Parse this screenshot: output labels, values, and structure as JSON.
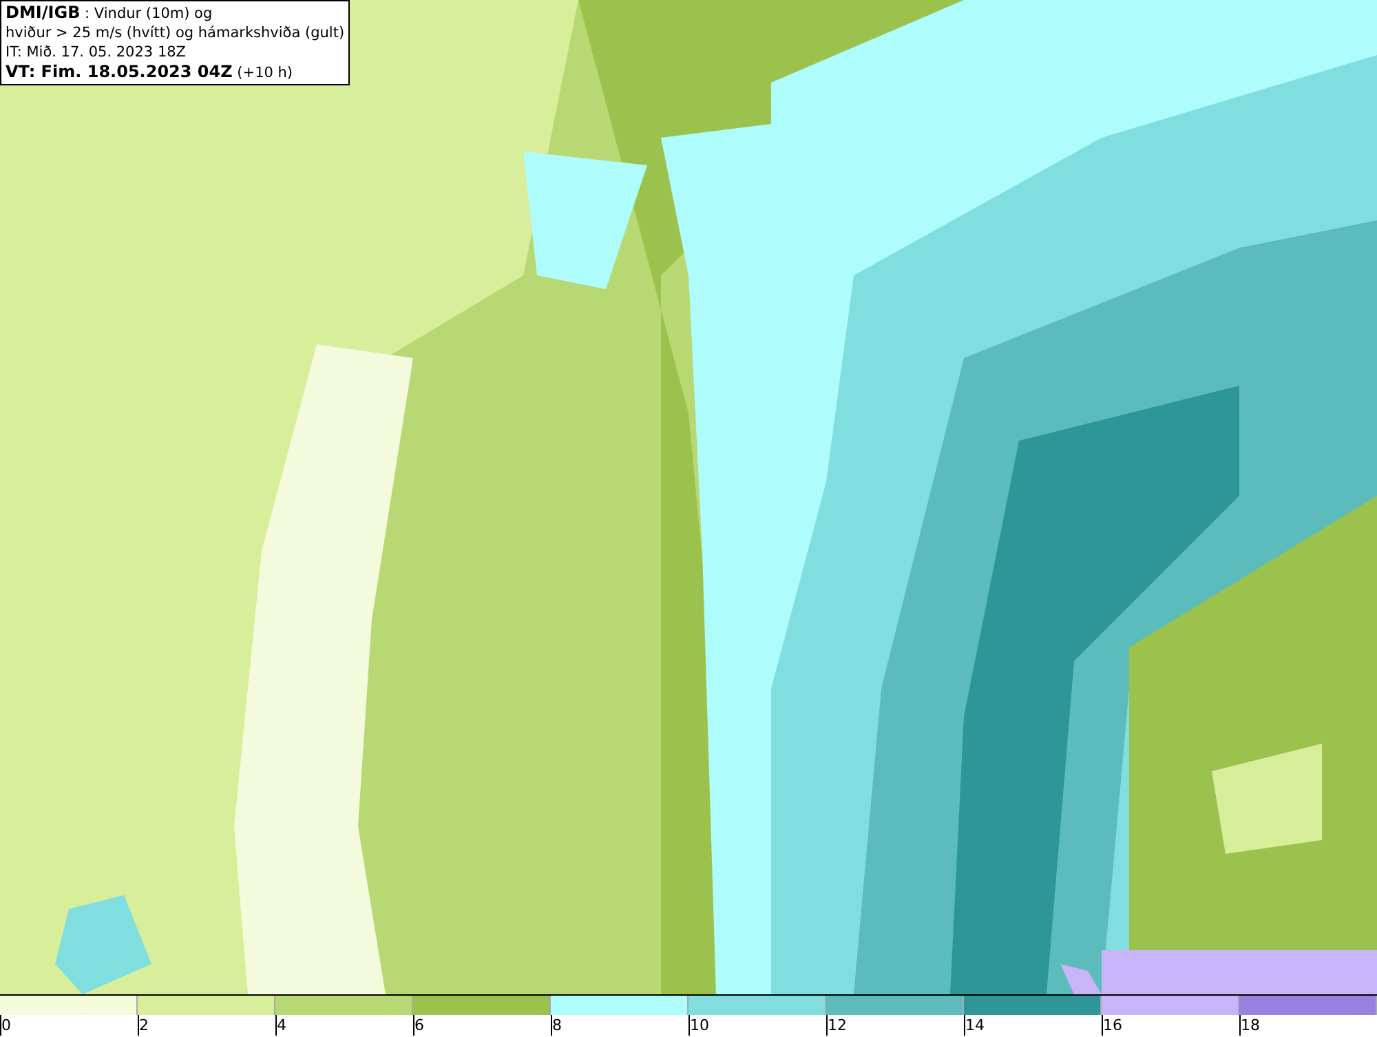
{
  "info_box": {
    "lines": [
      "**DMI/IGB** : Vindur (10m) og",
      "hviður > 25 m/s (hvítt) og hámarkshviða (gult)",
      "IT: Mið. 17. 05. 2023 18Z",
      "**VT: Fim. 18.05.2023 04Z** (+10 h)"
    ]
  },
  "legend": [
    {
      "label": "0",
      "color": "#f4fbdc"
    },
    {
      "label": "2",
      "color": "#d8ee9a"
    },
    {
      "label": "4",
      "color": "#b7d873"
    },
    {
      "label": "6",
      "color": "#9cc24e"
    },
    {
      "label": "8",
      "color": "#aefcfc"
    },
    {
      "label": "10",
      "color": "#80dede"
    },
    {
      "label": "12",
      "color": "#5cbcbc"
    },
    {
      "label": "14",
      "color": "#2e9696"
    },
    {
      "label": "16",
      "color": "#c8b4f8"
    },
    {
      "label": "18",
      "color": "#9a80e0"
    }
  ]
}
